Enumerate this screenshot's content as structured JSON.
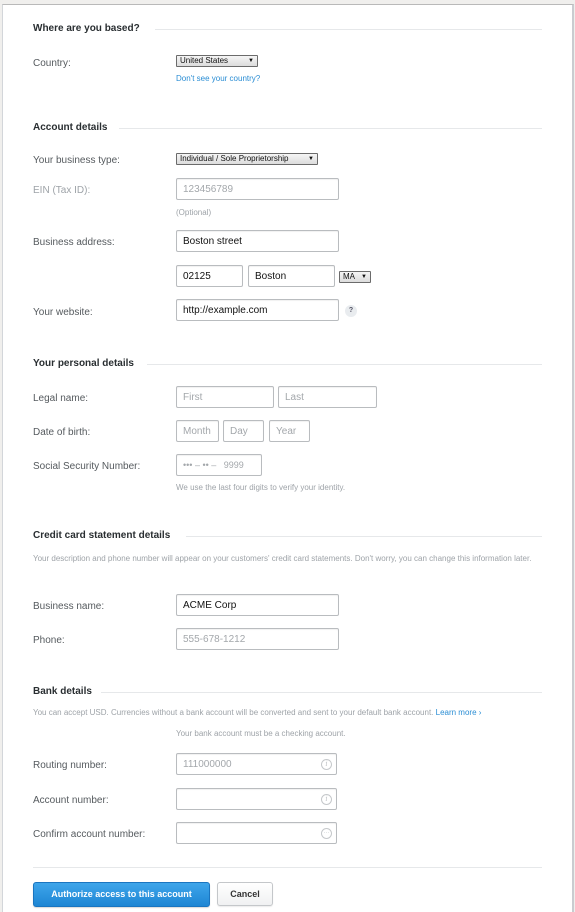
{
  "sections": {
    "location": {
      "title": "Where are you based?",
      "country_label": "Country:",
      "country_value": "United States",
      "country_link": "Don't see your country?"
    },
    "account": {
      "title": "Account details",
      "business_type_label": "Your business type:",
      "business_type_value": "Individual / Sole Proprietorship",
      "ein_label": "EIN (Tax ID):",
      "ein_placeholder": "123456789",
      "ein_hint": "(Optional)",
      "address_label": "Business address:",
      "address_value": "Boston street",
      "zip_value": "02125",
      "city_value": "Boston",
      "state_value": "MA",
      "website_label": "Your website:",
      "website_value": "http://example.com",
      "website_help": "?"
    },
    "personal": {
      "title": "Your personal details",
      "legal_name_label": "Legal name:",
      "first_placeholder": "First",
      "last_placeholder": "Last",
      "dob_label": "Date of birth:",
      "month_placeholder": "Month",
      "day_placeholder": "Day",
      "year_placeholder": "Year",
      "ssn_label": "Social Security Number:",
      "ssn_placeholder": "••• – •• –   9999",
      "ssn_hint": "We use the last four digits to verify your identity."
    },
    "statement": {
      "title": "Credit card statement details",
      "description": "Your description and phone number will appear on your customers' credit card statements. Don't worry, you can change this information later.",
      "business_name_label": "Business name:",
      "business_name_value": "ACME Corp",
      "phone_label": "Phone:",
      "phone_placeholder": "555-678-1212"
    },
    "bank": {
      "title": "Bank details",
      "description": "You can accept USD. Currencies without a bank account will be converted and sent to your default bank account.",
      "learn_more": "Learn more ›",
      "checking_note": "Your bank account must be a checking account.",
      "routing_label": "Routing number:",
      "routing_placeholder": "111000000",
      "account_label": "Account number:",
      "account_placeholder": "",
      "confirm_label": "Confirm account number:",
      "confirm_placeholder": ""
    }
  },
  "actions": {
    "authorize_label": "Authorize access to this account",
    "cancel_label": "Cancel"
  },
  "icons": {
    "info": "i",
    "ellipsis": "···",
    "dropdown": "▼"
  },
  "colors": {
    "primary": "#2a8dd4",
    "link": "#2a8dd4"
  }
}
